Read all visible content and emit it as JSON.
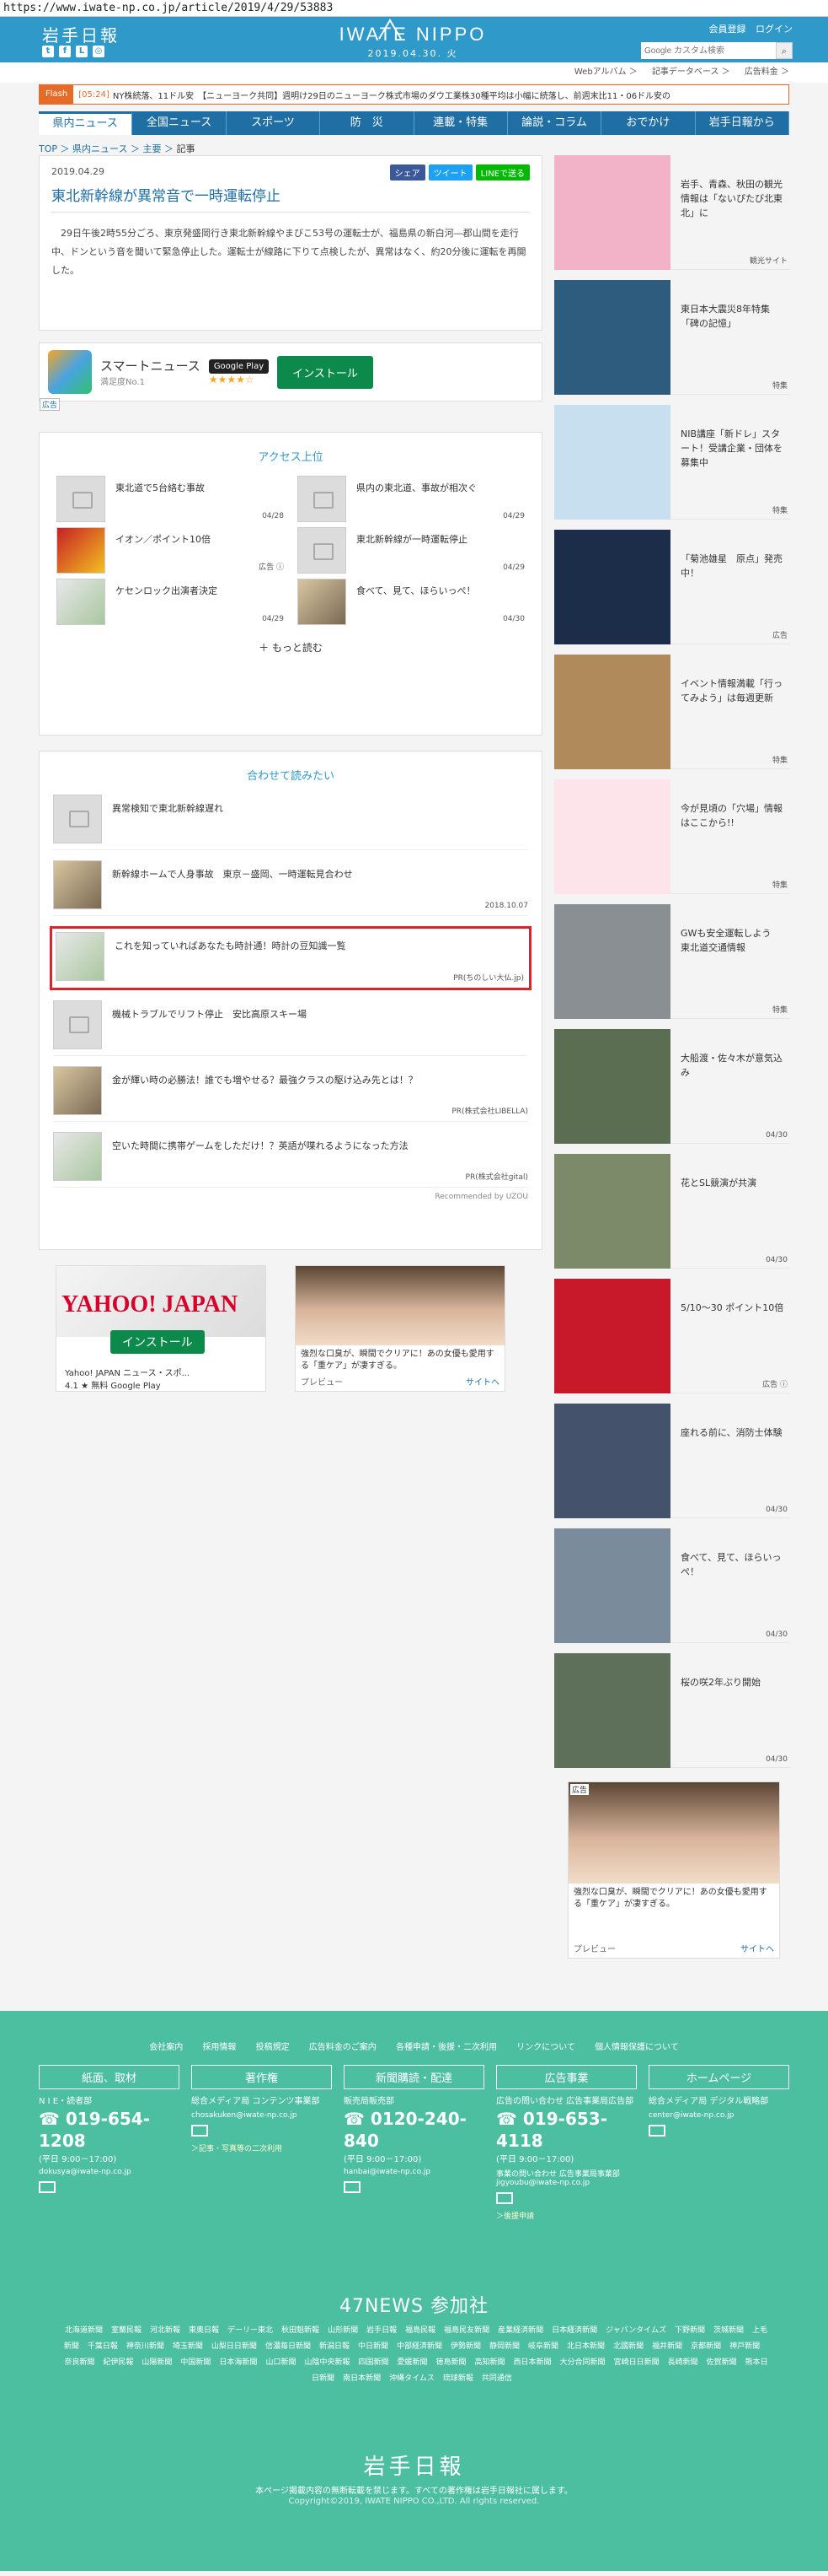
{
  "url": "https://www.iwate-np.co.jp/article/2019/4/29/53883",
  "header": {
    "logo_jp": "岩手日報",
    "logo_en": "IWATE NIPPO",
    "date_line": "2019.04.30. 火",
    "links": [
      "会員登録",
      "ログイン"
    ],
    "search_placeholder": "Google カスタム検索"
  },
  "subnav": [
    "Webアルバム ＞",
    "記事データベース ＞",
    "広告料金 ＞"
  ],
  "flash": {
    "tag": "Flash",
    "time": "[05:24]",
    "text": "NY株続落、11ドル安　【ニューヨーク共同】週明け29日のニューヨーク株式市場のダウ工業株30種平均は小幅に続落し、前週末比11・06ドル安の"
  },
  "gnav": [
    "県内ニュース",
    "全国ニュース",
    "スポーツ",
    "防　災",
    "連載・特集",
    "論説・コラム",
    "おでかけ",
    "岩手日報から"
  ],
  "breadcrumb": [
    "TOP",
    "県内ニュース",
    "主要",
    "記事"
  ],
  "article": {
    "date": "2019.04.29",
    "share": [
      "シェア",
      "ツイート",
      "LINEで送る"
    ],
    "title": "東北新幹線が異常音で一時運転停止",
    "body": "29日午後2時55分ごろ、東京発盛岡行き東北新幹線やまびこ53号の運転士が、福島県の新白河―郡山間を走行中、ドンという音を聞いて緊急停止した。運転士が線路に下りて点検したが、異常はなく、約20分後に運転を再開した。"
  },
  "app_banner": {
    "name": "スマートニュース",
    "sub": "満足度No.1",
    "store": "Google Play",
    "stars": "★★★★☆",
    "install": "インストール",
    "ad": "広告"
  },
  "access": {
    "title": "アクセス上位",
    "items": [
      {
        "title": "東北道で5台絡む事故",
        "date": "04/28"
      },
      {
        "title": "県内の東北道、事故が相次ぐ",
        "date": "04/29"
      },
      {
        "title": "イオン／ポイント10倍",
        "date": "広告 ⓘ"
      },
      {
        "title": "東北新幹線が一時運転停止",
        "date": "04/29"
      },
      {
        "title": "ケセンロック出演者決定",
        "date": "04/29"
      },
      {
        "title": "食べて、見て、ほらいっぺ！",
        "date": "04/30"
      }
    ],
    "more": "もっと読む"
  },
  "related": {
    "title": "合わせて読みたい",
    "items": [
      {
        "title": "異常検知で東北新幹線遅れ",
        "meta": ""
      },
      {
        "title": "新幹線ホームで人身事故　東京－盛岡、一時運転見合わせ",
        "meta": "2018.10.07"
      },
      {
        "title": "これを知っていればあなたも時計通！時計の豆知識一覧",
        "meta": "PR(ちのしい大仏.jp)"
      },
      {
        "title": "機械トラブルでリフト停止　安比高原スキー場",
        "meta": ""
      },
      {
        "title": "金が輝い時の必勝法！誰でも増やせる？最強クラスの駆け込み先とは！？",
        "meta": "PR(株式会社LIBELLA)"
      },
      {
        "title": "空いた時間に携帯ゲームをしただけ！？英語が喋れるようになった方法",
        "meta": "PR(株式会社gital)"
      }
    ],
    "recommended": "Recommended by UZOU"
  },
  "ads": {
    "yahoo_logo": "YAHOO! JAPAN",
    "yahoo_install": "インストール",
    "yahoo_app": "Yahoo! JAPAN ニュース・スポ...",
    "yahoo_rating": "4.1 ★ 無料   Google Play",
    "face_text": "強烈な口臭が、瞬間でクリアに！あの女優も愛用する「重ケア」が凄すぎる。",
    "face_preview": "プレビュー",
    "face_site": "サイトへ"
  },
  "side": [
    {
      "text": "岩手、青森、秋田の観光情報は「ないぴたび北東北」に",
      "tag": "観光サイト",
      "color": "#f2b3c9"
    },
    {
      "text": "東日本大震災8年特集「碑の記憶」",
      "tag": "特集",
      "color": "#2d5c7f"
    },
    {
      "text": "NIB講座「新ドレ」スタート！受講企業・団体を募集中",
      "tag": "特集",
      "color": "#c8dff0"
    },
    {
      "text": "「菊池雄星　原点」発売中！",
      "tag": "広告",
      "color": "#1c2d4a"
    },
    {
      "text": "イベント情報満載「行ってみよう」は毎週更新",
      "tag": "特集",
      "color": "#b08a5a"
    },
    {
      "text": "今が見頃の「穴場」情報はここから!!",
      "tag": "特集",
      "color": "#fde3ea"
    },
    {
      "text": "GWも安全運転しよう　東北道交通情報",
      "tag": "特集",
      "color": "#8a8f94"
    },
    {
      "text": "大船渡・佐々木が意気込み",
      "tag": "04/30",
      "color": "#5c6e52"
    },
    {
      "text": "花とSL競演が共演",
      "tag": "04/30",
      "color": "#7d8a6a"
    },
    {
      "text": "5/10～30 ポイント10倍",
      "tag": "広告 ⓘ",
      "color": "#c8192b"
    },
    {
      "text": "座れる前に、消防士体験",
      "tag": "04/30",
      "color": "#44526b"
    },
    {
      "text": "食べて、見て、ほらいっぺ！",
      "tag": "04/30",
      "color": "#7a8b9c"
    },
    {
      "text": "桜の咲2年ぶり開始",
      "tag": "04/30",
      "color": "#5e6f5a"
    }
  ],
  "side_ad": {
    "label": "広告",
    "text": "強烈な口臭が、瞬間でクリアに！あの女優も愛用する「重ケア」が凄すぎる。",
    "preview": "プレビュー",
    "site": "サイトへ"
  },
  "footer": {
    "links": [
      "会社案内",
      "採用情報",
      "投稿規定",
      "広告料金のご案内",
      "各種申請・後援・二次利用",
      "リンクについて",
      "個人情報保護について"
    ],
    "cols": [
      {
        "head": "紙面、取材",
        "l1": "N I E・読者部",
        "tel": "019-654-1208",
        "hours": "(平日 9:00－17:00)",
        "mail": "dokusya@iwate-np.co.jp",
        "link": ""
      },
      {
        "head": "著作権",
        "l1": "総合メディア局 コンテンツ事業部",
        "tel": "",
        "hours": "",
        "mail": "chosakuken@iwate-np.co.jp",
        "link": "＞記事・写真等の二次利用"
      },
      {
        "head": "新聞購読・配達",
        "l1": "販売局販売部",
        "tel": "0120-240-840",
        "hours": "(平日 9:00－17:00)",
        "mail": "hanbai@iwate-np.co.jp",
        "link": ""
      },
      {
        "head": "広告事業",
        "l1": "広告の問い合わせ 広告事業局広告部",
        "tel": "019-653-4118",
        "hours": "(平日 9:00－17:00)",
        "mail": "事業の問い合わせ 広告事業局事業部 jigyoubu@iwate-np.co.jp",
        "link": "＞後援申請"
      },
      {
        "head": "ホームページ",
        "l1": "総合メディア局 デジタル戦略部",
        "tel": "",
        "hours": "",
        "mail": "center@iwate-np.co.jp",
        "link": ""
      }
    ],
    "n47": "47NEWS 参加社",
    "papers": [
      "北海道新聞",
      "室蘭民報",
      "河北新報",
      "東奥日報",
      "デーリー東北",
      "秋田魁新報",
      "山形新聞",
      "岩手日報",
      "福島民報",
      "福島民友新聞",
      "産業経済新聞",
      "日本経済新聞",
      "ジャパンタイムズ",
      "下野新聞",
      "茨城新聞",
      "上毛新聞",
      "千葉日報",
      "神奈川新聞",
      "埼玉新聞",
      "山梨日日新聞",
      "信濃毎日新聞",
      "新潟日報",
      "中日新聞",
      "中部経済新聞",
      "伊勢新聞",
      "静岡新聞",
      "岐阜新聞",
      "北日本新聞",
      "北國新聞",
      "福井新聞",
      "京都新聞",
      "神戸新聞",
      "奈良新聞",
      "紀伊民報",
      "山陽新聞",
      "中国新聞",
      "日本海新聞",
      "山口新聞",
      "山陰中央新報",
      "四国新聞",
      "愛媛新聞",
      "徳島新聞",
      "高知新聞",
      "西日本新聞",
      "大分合同新聞",
      "宮崎日日新聞",
      "長崎新聞",
      "佐賀新聞",
      "熊本日日新聞",
      "南日本新聞",
      "沖縄タイムス",
      "琉球新報",
      "共同通信"
    ],
    "logo": "岩手日報",
    "note": "本ページ掲載内容の無断転載を禁じます。すべての著作権は岩手日報社に属します。",
    "copy": "Copyright©2019, IWATE NIPPO CO.,LTD. All rights reserved."
  }
}
